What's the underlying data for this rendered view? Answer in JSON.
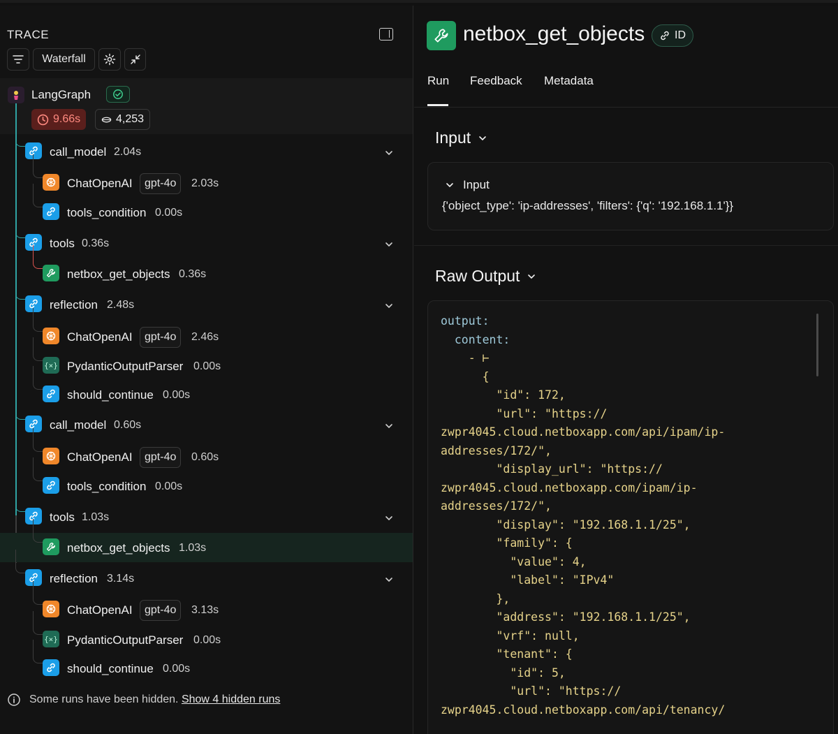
{
  "trace": {
    "title": "TRACE",
    "toolbar": {
      "view_label": "Waterfall"
    },
    "root": {
      "name": "LangGraph",
      "latency": "9.66s",
      "tokens": "4,253"
    },
    "rows": [
      {
        "name": "call_model",
        "dur": "2.04s",
        "icon": "link-icon"
      },
      {
        "name": "ChatOpenAI",
        "tag": "gpt-4o",
        "dur": "2.03s",
        "icon": "openai-icon"
      },
      {
        "name": "tools_condition",
        "dur": "0.00s",
        "icon": "link-icon"
      },
      {
        "name": "tools",
        "dur": "0.36s",
        "icon": "link-icon"
      },
      {
        "name": "netbox_get_objects",
        "dur": "0.36s",
        "icon": "wrench-icon"
      },
      {
        "name": "reflection",
        "dur": "2.48s",
        "icon": "link-icon"
      },
      {
        "name": "ChatOpenAI",
        "tag": "gpt-4o",
        "dur": "2.46s",
        "icon": "openai-icon"
      },
      {
        "name": "PydanticOutputParser",
        "dur": "0.00s",
        "icon": "braces-icon"
      },
      {
        "name": "should_continue",
        "dur": "0.00s",
        "icon": "link-icon"
      },
      {
        "name": "call_model",
        "dur": "0.60s",
        "icon": "link-icon"
      },
      {
        "name": "ChatOpenAI",
        "tag": "gpt-4o",
        "dur": "0.60s",
        "icon": "openai-icon"
      },
      {
        "name": "tools_condition",
        "dur": "0.00s",
        "icon": "link-icon"
      },
      {
        "name": "tools",
        "dur": "1.03s",
        "icon": "link-icon"
      },
      {
        "name": "netbox_get_objects",
        "dur": "1.03s",
        "icon": "wrench-icon"
      },
      {
        "name": "reflection",
        "dur": "3.14s",
        "icon": "link-icon"
      },
      {
        "name": "ChatOpenAI",
        "tag": "gpt-4o",
        "dur": "3.13s",
        "icon": "openai-icon"
      },
      {
        "name": "PydanticOutputParser",
        "dur": "0.00s",
        "icon": "braces-icon"
      },
      {
        "name": "should_continue",
        "dur": "0.00s",
        "icon": "link-icon"
      }
    ],
    "hidden_note": {
      "text": "Some runs have been hidden.",
      "link": "Show 4 hidden runs"
    }
  },
  "detail": {
    "title": "netbox_get_objects",
    "id_label": "ID",
    "tabs": [
      "Run",
      "Feedback",
      "Metadata"
    ],
    "input_section": "Input",
    "input_card_label": "Input",
    "input_value": "{'object_type': 'ip-addresses', 'filters': {'q': '192.168.1.1'}}",
    "raw_output_section": "Raw Output",
    "raw_output_lines": [
      "output:",
      "  content:",
      "    - ⊢",
      "      {",
      "        \"id\": 172,",
      "        \"url\": \"https://",
      "zwpr4045.cloud.netboxapp.com/api/ipam/ip-",
      "addresses/172/\",",
      "        \"display_url\": \"https://",
      "zwpr4045.cloud.netboxapp.com/ipam/ip-",
      "addresses/172/\",",
      "        \"display\": \"192.168.1.1/25\",",
      "        \"family\": {",
      "          \"value\": 4,",
      "          \"label\": \"IPv4\"",
      "        },",
      "        \"address\": \"192.168.1.1/25\",",
      "        \"vrf\": null,",
      "        \"tenant\": {",
      "          \"id\": 5,",
      "          \"url\": \"https://",
      "zwpr4045.cloud.netboxapp.com/api/tenancy/"
    ]
  },
  "colors": {
    "link": "#1b9ee8",
    "openai": "#f0872a",
    "tool": "#1f9b5f",
    "latency_bg": "#5a1f1c",
    "latency_fg": "#ff8a80"
  }
}
